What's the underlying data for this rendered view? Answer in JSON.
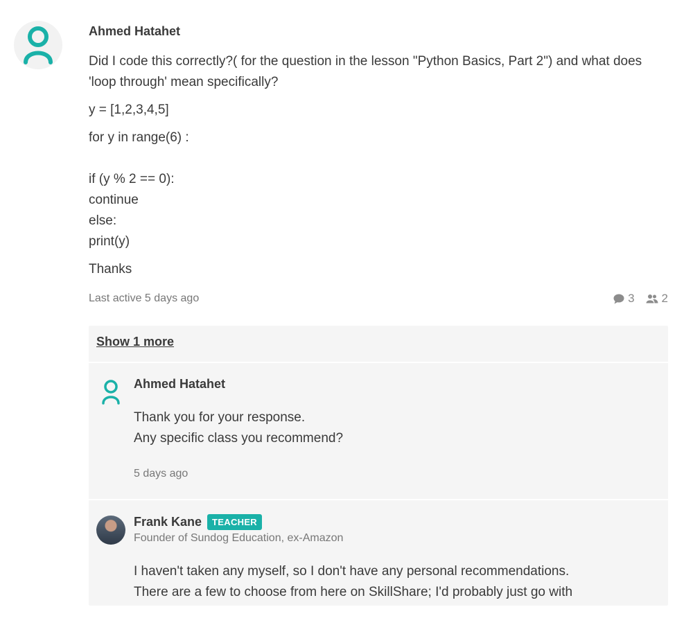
{
  "post": {
    "author": "Ahmed Hatahet",
    "question": "Did I code this correctly?( for the question in the lesson \"Python Basics, Part 2\") and what does 'loop through' mean specifically?",
    "code_lines": {
      "l1": "y = [1,2,3,4,5]",
      "l2": "for y in range(6) :",
      "l3": "if (y % 2 == 0):",
      "l4": "continue",
      "l5": "else:",
      "l6": "print(y)"
    },
    "closing": "Thanks",
    "last_active": "Last active 5 days ago",
    "comment_count": "3",
    "participant_count": "2",
    "avatar_icon": "user-outline-icon",
    "accent_color": "#1ab1a8"
  },
  "replies": {
    "show_more_label": "Show 1 more",
    "reply1": {
      "author": "Ahmed Hatahet",
      "line1": "Thank you for your response.",
      "line2": "Any specific class you recommend?",
      "time": "5 days ago"
    },
    "reply2": {
      "author": "Frank Kane",
      "badge": "TEACHER",
      "title": "Founder of Sundog Education, ex-Amazon",
      "line1": "I haven't taken any myself, so I don't have any personal recommendations.",
      "line2": "There are a few to choose from here on SkillShare; I'd probably just go with"
    }
  }
}
